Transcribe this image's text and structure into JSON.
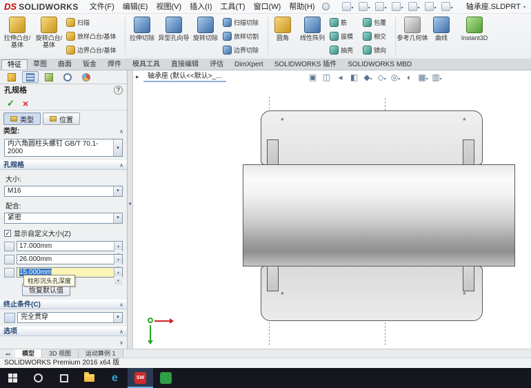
{
  "titlebar": {
    "logo_prefix": "DS",
    "logo_brand": "SOLIDWORKS",
    "menus": [
      "文件(F)",
      "编辑(E)",
      "视图(V)",
      "插入(I)",
      "工具(T)",
      "窗口(W)",
      "帮助(H)"
    ],
    "doc_title": "轴承座.SLDPRT",
    "quick_toolbar_icons": [
      "new-document",
      "open",
      "save",
      "print",
      "undo",
      "rebuild",
      "options"
    ]
  },
  "ribbon": {
    "large": [
      "拉伸凸台/基体",
      "旋转凸台/基体",
      "拉伸切除",
      "异型孔向导",
      "旋转切除",
      "圆角",
      "线性阵列",
      "参考几何体",
      "曲线",
      "Instant3D"
    ],
    "small_groups": [
      [
        "扫描",
        "放样凸台/基体",
        "边界凸台/基体"
      ],
      [
        "扫描切除",
        "放样切割",
        "边界切除"
      ],
      [
        "筋",
        "拔模",
        "抽壳"
      ],
      [
        "包覆",
        "相交",
        "镜向"
      ]
    ],
    "tabs": [
      "特征",
      "草图",
      "曲面",
      "钣金",
      "焊件",
      "模具工具",
      "直接编辑",
      "评估",
      "DimXpert",
      "SOLIDWORKS 插件",
      "SOLIDWORKS MBD"
    ],
    "active_tab": "特征"
  },
  "manager_tabs": [
    "feature-manager",
    "property-manager",
    "configuration-manager",
    "dimxpert-manager",
    "display-manager"
  ],
  "property_manager": {
    "title": "孔规格",
    "tabs": {
      "type": "类型",
      "position": "位置",
      "active": "类型"
    },
    "type_group": {
      "header": "类型:",
      "standard": "内六角圆柱头螺钉 GB/T 70.1-2000"
    },
    "hole_spec": {
      "header": "孔规格",
      "size_label": "大小:",
      "size": "M16",
      "fit_label": "配合:",
      "fit": "紧密",
      "custom_size_label": "显示自定义大小(Z)",
      "custom_size_checked": true,
      "values": {
        "through_hole_diameter": "17.000mm",
        "cbore_diameter": "26.000mm",
        "cbore_depth": "15.000mm"
      },
      "selected_field": "cbore_depth",
      "tooltip": "柱形沉头孔深度",
      "restore_button": "恢复默认值"
    },
    "end_condition": {
      "header": "终止条件(C)",
      "value": "完全贯穿"
    },
    "options_header": "选项"
  },
  "viewport": {
    "doc_tab": "轴承座 (默认<<默认>_...",
    "marker": "*",
    "headsup_icons": [
      "zoom-to-fit",
      "zoom-to-area",
      "previous-view",
      "section-view",
      "view-orientation",
      "display-style",
      "hide-show-items",
      "edit-appearance",
      "apply-scene",
      "view-settings"
    ]
  },
  "bottom_tabs": {
    "model": "模型",
    "view3d": "3D 视图",
    "motion": "运动算例 1",
    "active": "模型"
  },
  "statusbar": "SOLIDWORKS Premium 2016 x64 版",
  "taskbar": {
    "apps": [
      "start",
      "search",
      "task-view",
      "file-explorer",
      "edge",
      "solidworks",
      "green-app"
    ],
    "edge_glyph": "e",
    "sw_glyph": "SW"
  },
  "colors": {
    "accent_selection": "#3173c5",
    "tooltip_bg": "#fffee6",
    "sw_red": "#cf2b2b"
  }
}
